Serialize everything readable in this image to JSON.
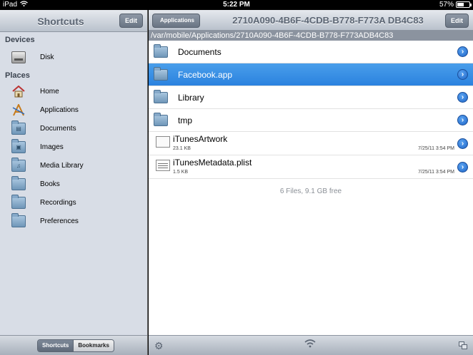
{
  "status": {
    "carrier": "iPad",
    "time": "5:22 PM",
    "battery": "57%",
    "battery_level": 0.57
  },
  "left": {
    "title": "Shortcuts",
    "edit_label": "Edit",
    "devices_header": "Devices",
    "devices": [
      {
        "label": "Disk",
        "icon": "disk-icon"
      }
    ],
    "places_header": "Places",
    "places": [
      {
        "label": "Home",
        "icon": "home-icon"
      },
      {
        "label": "Applications",
        "icon": "applications-icon"
      },
      {
        "label": "Documents",
        "icon": "folder-icon"
      },
      {
        "label": "Images",
        "icon": "images-folder-icon"
      },
      {
        "label": "Media Library",
        "icon": "music-folder-icon"
      },
      {
        "label": "Books",
        "icon": "folder-icon"
      },
      {
        "label": "Recordings",
        "icon": "folder-icon"
      },
      {
        "label": "Preferences",
        "icon": "folder-icon"
      }
    ],
    "segments": {
      "shortcuts": "Shortcuts",
      "bookmarks": "Bookmarks",
      "selected": "Shortcuts"
    }
  },
  "right": {
    "back_label": "Applications",
    "title": "2710A090-4B6F-4CDB-B778-F773A DB4C83",
    "edit_label": "Edit",
    "path": "/var/mobile/Applications/2710A090-4B6F-4CDB-B778-F773ADB4C83",
    "rows": [
      {
        "name": "Documents",
        "type": "folder"
      },
      {
        "name": "Facebook.app",
        "type": "folder",
        "selected": true
      },
      {
        "name": "Library",
        "type": "folder"
      },
      {
        "name": "tmp",
        "type": "folder"
      },
      {
        "name": "iTunesArtwork",
        "type": "file",
        "size": "23.1 KB",
        "date": "7/25/11 3:54 PM"
      },
      {
        "name": "iTunesMetadata.plist",
        "type": "file",
        "size": "1.5 KB",
        "date": "7/25/11 3:54 PM"
      }
    ],
    "summary": "6 Files, 9.1 GB free"
  },
  "colors": {
    "selection": "#2b82df",
    "sidebar": "#d8dde6",
    "bar": "#b9c1cc"
  }
}
